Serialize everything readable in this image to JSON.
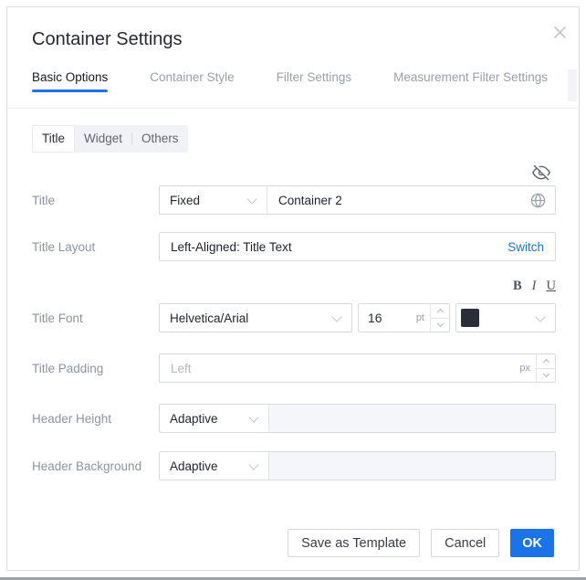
{
  "dialog": {
    "title": "Container Settings"
  },
  "tabs": [
    {
      "label": "Basic Options",
      "active": true
    },
    {
      "label": "Container Style",
      "active": false
    },
    {
      "label": "Filter Settings",
      "active": false
    },
    {
      "label": "Measurement Filter Settings",
      "active": false
    }
  ],
  "subtabs": [
    {
      "label": "Title",
      "active": true
    },
    {
      "label": "Widget",
      "active": false
    },
    {
      "label": "Others",
      "active": false
    }
  ],
  "form": {
    "title": {
      "label": "Title",
      "source": "Fixed",
      "value": "Container 2"
    },
    "title_layout": {
      "label": "Title Layout",
      "value": "Left-Aligned: Title Text",
      "switch_label": "Switch"
    },
    "text_format": {
      "bold": "B",
      "italic": "I",
      "underline": "U"
    },
    "title_font": {
      "label": "Title Font",
      "family": "Helvetica/Arial",
      "size": "16",
      "size_unit": "pt",
      "color": "#2b2e39"
    },
    "title_padding": {
      "label": "Title Padding",
      "placeholder": "Left",
      "unit": "px"
    },
    "header_height": {
      "label": "Header Height",
      "mode": "Adaptive"
    },
    "header_background": {
      "label": "Header Background",
      "mode": "Adaptive"
    }
  },
  "footer": {
    "save_as_template": "Save as Template",
    "cancel": "Cancel",
    "ok": "OK"
  },
  "icons": {
    "close": "close-icon",
    "hide": "eye-off-icon",
    "globe": "globe-icon"
  },
  "colors": {
    "accent": "#1a73e8",
    "title_font_swatch": "#2b2e39"
  }
}
